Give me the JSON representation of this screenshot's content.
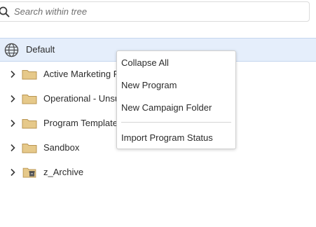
{
  "search": {
    "placeholder": "Search within tree",
    "value": ""
  },
  "tree": {
    "root": {
      "label": "Default",
      "icon": "globe-icon"
    },
    "items": [
      {
        "label": "Active Marketing P",
        "icon": "folder-icon"
      },
      {
        "label": "Operational - Unsu",
        "icon": "folder-icon"
      },
      {
        "label": "Program Template",
        "icon": "folder-icon"
      },
      {
        "label": "Sandbox",
        "icon": "folder-icon"
      },
      {
        "label": "z_Archive",
        "icon": "archive-folder-icon"
      }
    ]
  },
  "context_menu": {
    "items": [
      {
        "label": "Collapse All"
      },
      {
        "label": "New Program"
      },
      {
        "label": "New Campaign Folder"
      },
      {
        "label": "Import Program Status"
      }
    ]
  },
  "colors": {
    "selected_row": "#e5eefb",
    "folder": "#e6c98a",
    "folder_stroke": "#b99552"
  }
}
